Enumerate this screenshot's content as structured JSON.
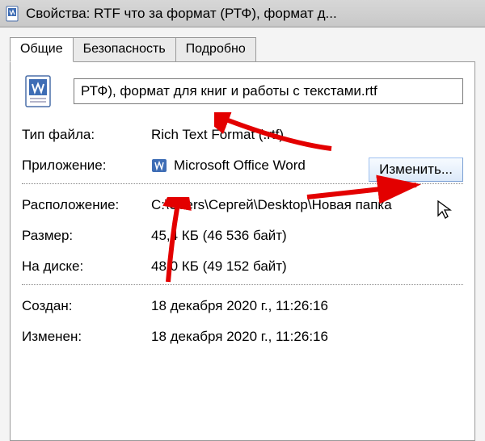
{
  "window": {
    "title": "Свойства: RTF что за формат (РТФ), формат д..."
  },
  "tabs": {
    "t1": "Общие",
    "t2": "Безопасность",
    "t3": "Подробно"
  },
  "filename": "РТФ), формат для книг и работы с текстами.rtf",
  "labels": {
    "filetype": "Тип файла:",
    "application": "Приложение:",
    "location": "Расположение:",
    "size": "Размер:",
    "ondisk": "На диске:",
    "created": "Создан:",
    "modified": "Изменен:"
  },
  "values": {
    "filetype": "Rich Text Format (.rtf)",
    "application": "Microsoft Office Word",
    "location": "C:\\Users\\Сергей\\Desktop\\Новая папка",
    "size": "45,4 КБ (46 536 байт)",
    "ondisk": "48,0 КБ (49 152 байт)",
    "created": "18 декабря 2020 г., 11:26:16",
    "modified": "18 декабря 2020 г., 11:26:16"
  },
  "buttons": {
    "change": "Изменить..."
  }
}
